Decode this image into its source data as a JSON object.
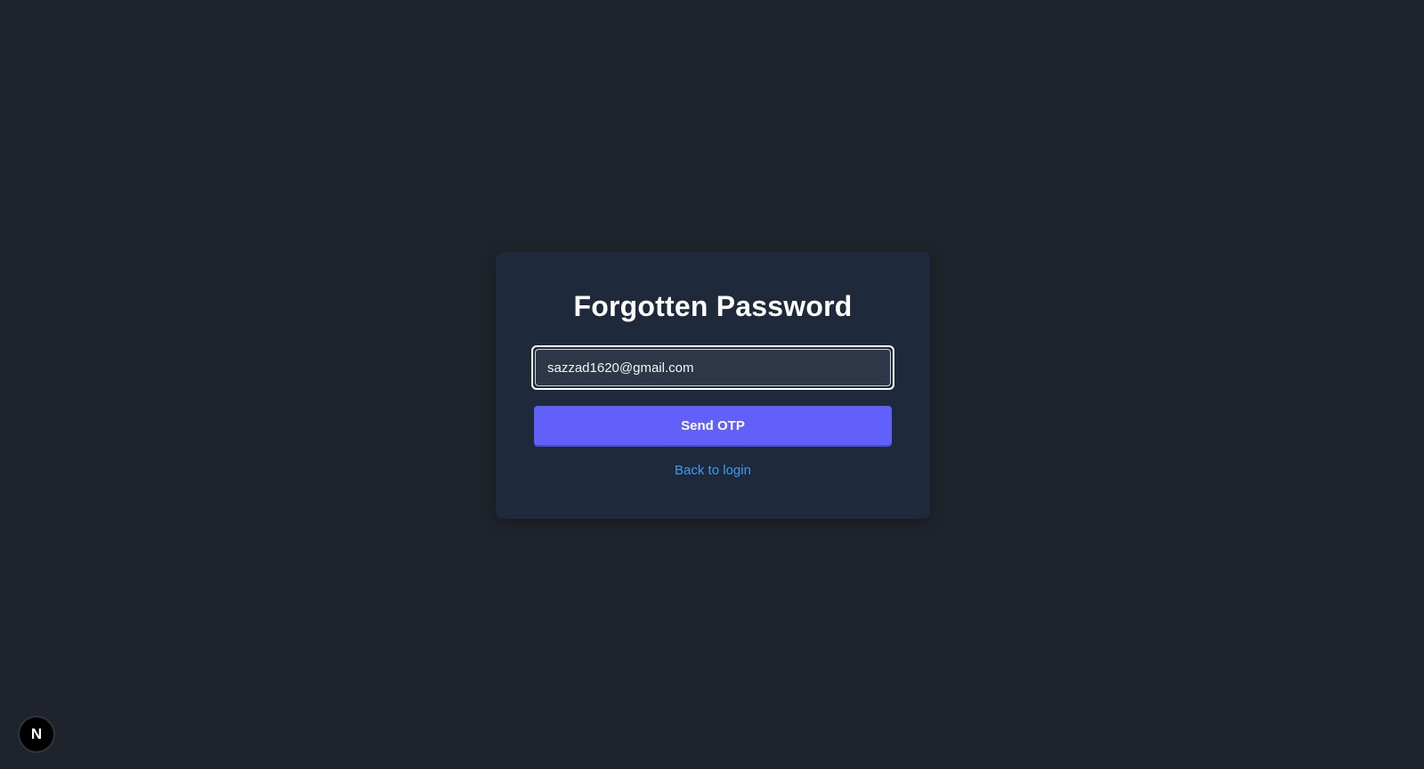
{
  "form": {
    "title": "Forgotten Password",
    "email_value": "sazzad1620@gmail.com",
    "send_button_label": "Send OTP",
    "back_link_label": "Back to login"
  },
  "dev_badge": {
    "letter": "N",
    "icon": "nextjs-logo-icon"
  },
  "colors": {
    "background": "#1f232b",
    "card": "#1e293b",
    "accent": "#6160fa",
    "link": "#3b9cf0"
  }
}
